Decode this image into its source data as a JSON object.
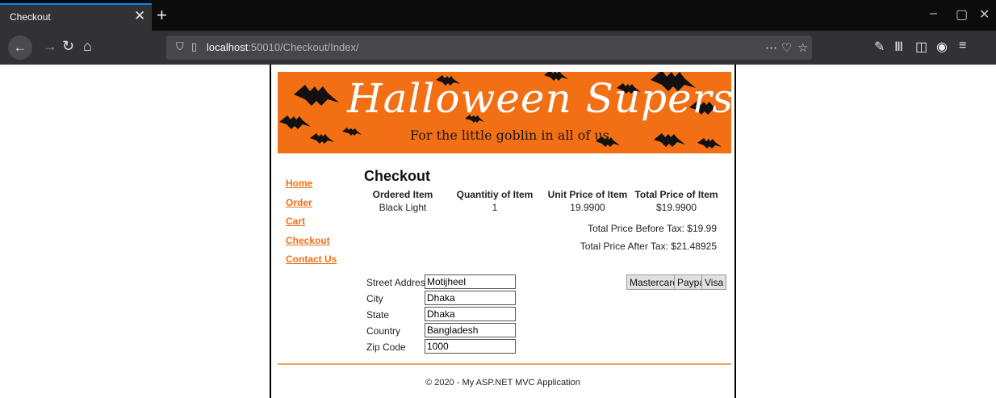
{
  "browser": {
    "tab_title": "Checkout",
    "tab_close_glyph": "✕",
    "new_tab_glyph": "+",
    "url_host": "localhost",
    "url_path": ":50010/Checkout/Index/",
    "window_controls": [
      "–",
      "▢",
      "✕"
    ]
  },
  "banner": {
    "title": "Halloween Superstore",
    "subtitle": "For the little goblin in all of us",
    "color": "#f26f14"
  },
  "nav": {
    "items": [
      "Home",
      "Order",
      "Cart",
      "Checkout",
      "Contact Us"
    ]
  },
  "checkout": {
    "title": "Checkout",
    "columns": [
      "Ordered Item",
      "Quantitiy of Item",
      "Unit Price of Item",
      "Total Price of Item"
    ],
    "rows": [
      [
        "Black Light",
        "1",
        "19.9900",
        "$19.9900"
      ]
    ],
    "total_before_tax": "Total Price Before Tax: $19.99",
    "total_after_tax": "Total Price After Tax: $21.48925"
  },
  "address": {
    "street_label": "Street Address",
    "street_value": "Motijheel",
    "city_label": "City",
    "city_value": "Dhaka",
    "state_label": "State",
    "state_value": "Dhaka",
    "country_label": "Country",
    "country_value": "Bangladesh",
    "zip_label": "Zip Code",
    "zip_value": "1000"
  },
  "payment": {
    "mastercard": "Mastercard",
    "paypal": "Paypal",
    "visa": "Visa"
  },
  "footer": {
    "text": "© 2020 - My ASP.NET MVC Application"
  }
}
